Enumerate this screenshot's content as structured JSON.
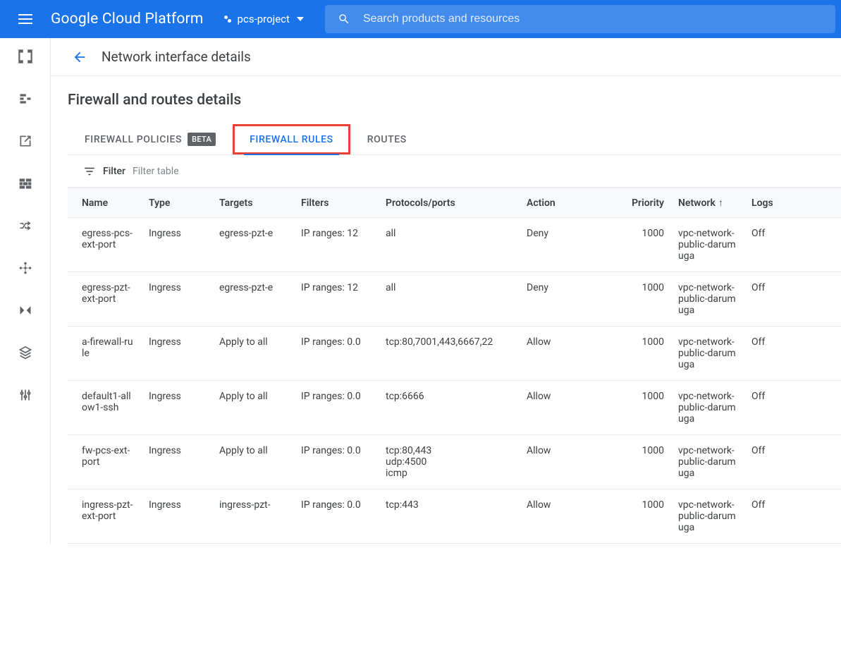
{
  "header": {
    "brand": "Google Cloud Platform",
    "project": "pcs-project",
    "search_placeholder": "Search products and resources"
  },
  "page": {
    "title": "Network interface details",
    "section_title": "Firewall and routes details"
  },
  "tabs": [
    {
      "label": "FIREWALL POLICIES",
      "badge": "BETA",
      "active": false,
      "highlight": false
    },
    {
      "label": "FIREWALL RULES",
      "badge": null,
      "active": true,
      "highlight": true
    },
    {
      "label": "ROUTES",
      "badge": null,
      "active": false,
      "highlight": false
    }
  ],
  "filter": {
    "label": "Filter",
    "placeholder": "Filter table"
  },
  "columns": [
    "Name",
    "Type",
    "Targets",
    "Filters",
    "Protocols/ports",
    "Action",
    "Priority",
    "Network",
    "Logs"
  ],
  "sort": {
    "column": "Network",
    "dir": "asc"
  },
  "rows": [
    {
      "name": "egress-pcs-ext-port",
      "type": "Ingress",
      "targets": "egress-pzt-e",
      "filters": "IP ranges: 12",
      "protocols": "all",
      "action": "Deny",
      "priority": "1000",
      "network": "vpc-network-public-darumuga",
      "logs": "Off"
    },
    {
      "name": "egress-pzt-ext-port",
      "type": "Ingress",
      "targets": "egress-pzt-e",
      "filters": "IP ranges: 12",
      "protocols": "all",
      "action": "Deny",
      "priority": "1000",
      "network": "vpc-network-public-darumuga",
      "logs": "Off"
    },
    {
      "name": "a-firewall-rule",
      "type": "Ingress",
      "targets": "Apply to all",
      "filters": "IP ranges: 0.0",
      "protocols": "tcp:80,7001,443,6667,22",
      "action": "Allow",
      "priority": "1000",
      "network": "vpc-network-public-darumuga",
      "logs": "Off"
    },
    {
      "name": "default1-allow1-ssh",
      "type": "Ingress",
      "targets": "Apply to all",
      "filters": "IP ranges: 0.0",
      "protocols": "tcp:6666",
      "action": "Allow",
      "priority": "1000",
      "network": "vpc-network-public-darumuga",
      "logs": "Off"
    },
    {
      "name": "fw-pcs-ext-port",
      "type": "Ingress",
      "targets": "Apply to all",
      "filters": "IP ranges: 0.0",
      "protocols": "tcp:80,443\nudp:4500\nicmp",
      "action": "Allow",
      "priority": "1000",
      "network": "vpc-network-public-darumuga",
      "logs": "Off"
    },
    {
      "name": "ingress-pzt-ext-port",
      "type": "Ingress",
      "targets": "ingress-pzt-",
      "filters": "IP ranges: 0.0",
      "protocols": "tcp:443",
      "action": "Allow",
      "priority": "1000",
      "network": "vpc-network-public-darumuga",
      "logs": "Off"
    }
  ]
}
